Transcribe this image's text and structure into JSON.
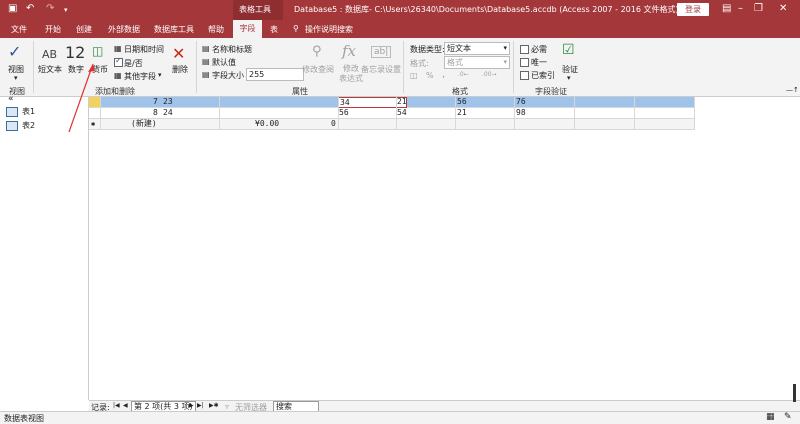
{
  "window": {
    "title": "Database5 : 数据库- C:\\Users\\26340\\Documents\\Database5.accdb (Access 2007 - 2016 文件格式) - Acc...",
    "context_tab": "表格工具",
    "login_label": "登录"
  },
  "menu": {
    "items": [
      "文件",
      "开始",
      "创建",
      "外部数据",
      "数据库工具",
      "帮助",
      "字段",
      "表"
    ],
    "search": "操作说明搜索"
  },
  "ribbon": {
    "view_label": "视图",
    "short_text": "短文本",
    "number_big": "12",
    "number_label": "数字",
    "currency_label": "货币",
    "date_time": "日期和时间",
    "yes_no": "是/否",
    "more_fields": "其他字段",
    "delete_label": "删除",
    "name_caption": "名称和标题",
    "default_value": "默认值",
    "field_size_label": "字段大小",
    "field_size_value": "255",
    "modify_lookups": "修改查阅",
    "modify_expression": "修改\n表达式",
    "memo_settings": "备忘录设置",
    "data_type_label": "数据类型:",
    "data_type_value": "短文本",
    "format_label": "格式:",
    "format_value": "格式",
    "required": "必需",
    "unique": "唯一",
    "indexed": "已索引",
    "validation": "验证",
    "groups": {
      "view": "视图",
      "add_delete": "添加和删除",
      "properties": "属性",
      "formatting": "格式",
      "validation": "字段验证"
    }
  },
  "nav": {
    "tables": [
      "表1",
      "表2"
    ]
  },
  "grid": {
    "rows": [
      {
        "c1": "7",
        "c2": "23",
        "c4": "34",
        "c5": "21",
        "c6": "56",
        "c7": "76"
      },
      {
        "c1": "8",
        "c2": "24",
        "c4": "56",
        "c5": "54",
        "c6": "21",
        "c7": "98"
      }
    ],
    "new_row": {
      "c2": "(新建)",
      "c3": "¥0.00",
      "c4": "0"
    }
  },
  "recnav": {
    "label": "记录:",
    "position": "第 2 项(共 3 项)",
    "no_filter": "无筛选器",
    "search": "搜索"
  },
  "status": {
    "mode": "数据表视图"
  }
}
